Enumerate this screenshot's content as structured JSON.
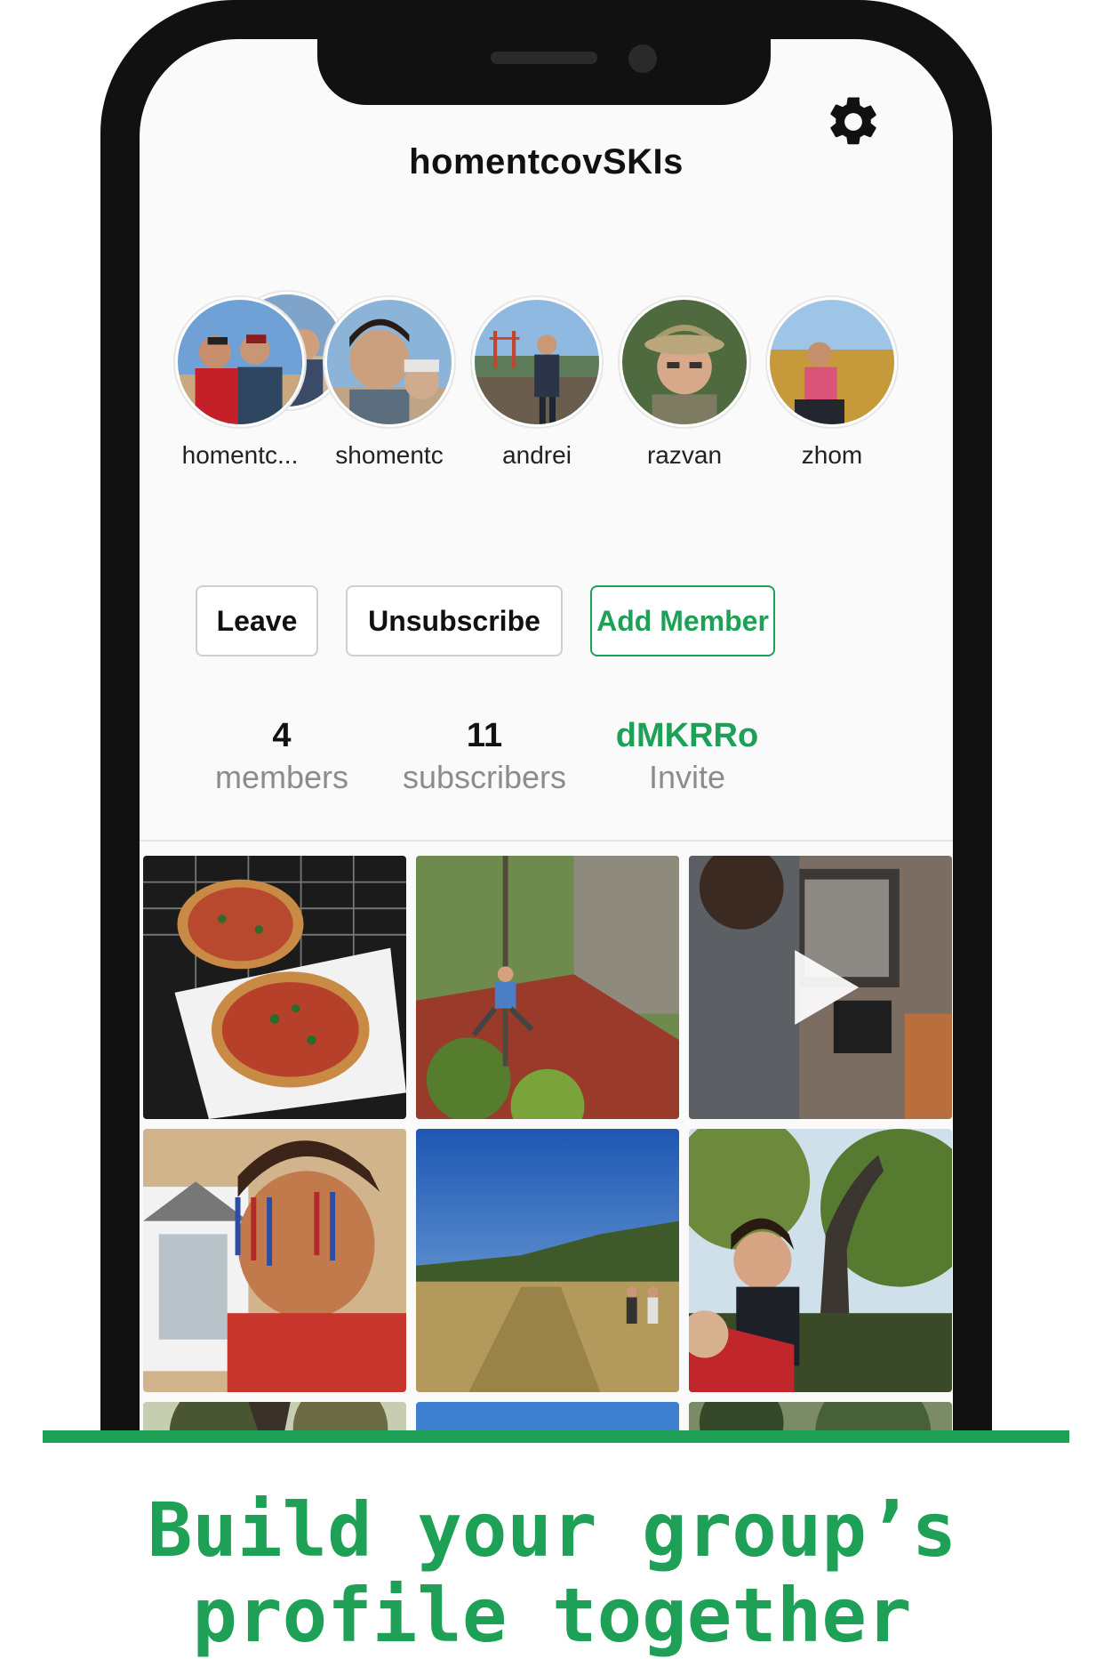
{
  "group": {
    "title": "homentcovSKIs"
  },
  "icons": {
    "settings": "gear-icon",
    "play": "play-icon"
  },
  "members": [
    {
      "name": "homentc..."
    },
    {
      "name": "shomentc"
    },
    {
      "name": "andrei"
    },
    {
      "name": "razvan"
    },
    {
      "name": "zhom"
    }
  ],
  "actions": {
    "leave_label": "Leave",
    "unsubscribe_label": "Unsubscribe",
    "add_member_label": "Add Member"
  },
  "stats": {
    "members_count": "4",
    "members_label": "members",
    "subscribers_count": "11",
    "subscribers_label": "subscribers",
    "invite_code": "dMKRRo",
    "invite_label": "Invite"
  },
  "tagline": {
    "line1": "Build your group’s",
    "line2": "profile together"
  },
  "colors": {
    "accent": "#1fa057",
    "text": "#111111",
    "muted": "#8c8c8c"
  }
}
